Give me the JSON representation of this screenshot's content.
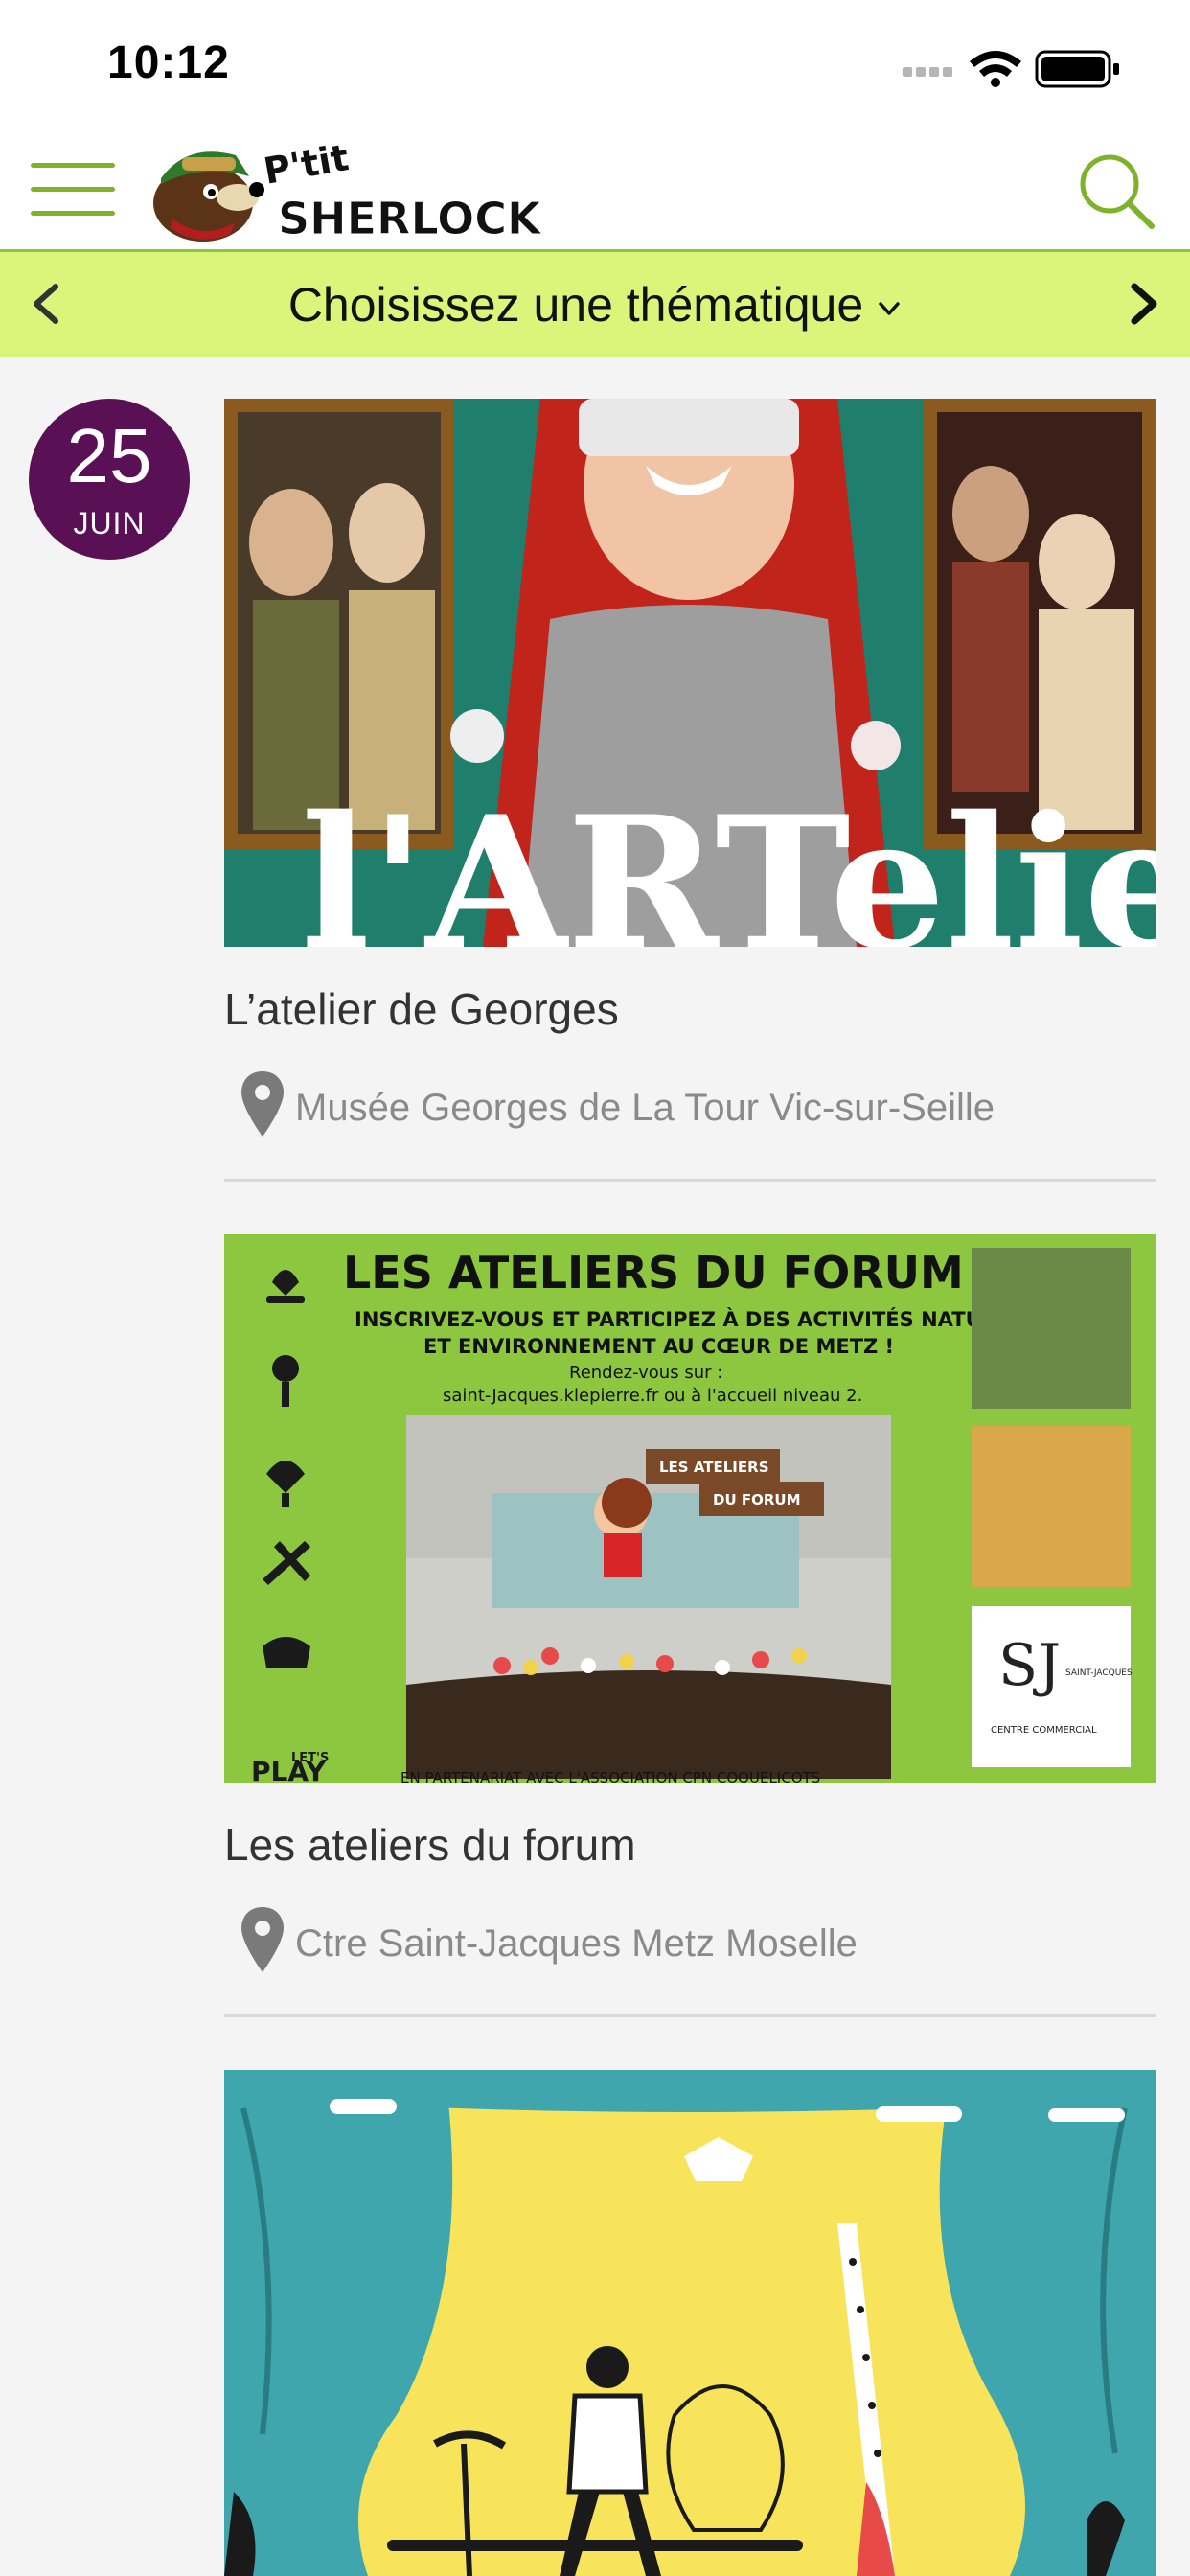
{
  "status": {
    "time": "10:12"
  },
  "header": {
    "logo_text_top": "P'tit",
    "logo_text_bottom": "SHERLOCK"
  },
  "theme_bar": {
    "title": "Choisissez une thématique"
  },
  "date": {
    "day": "25",
    "month": "JUIN"
  },
  "events": [
    {
      "title": "L’atelier de Georges",
      "location": "Musée Georges de La Tour Vic-sur-Seille",
      "image_text": "l'ARTelier"
    },
    {
      "title": "Les ateliers du forum",
      "location": "Ctre Saint-Jacques Metz Moselle",
      "image_text": {
        "headline": "LES ATELIERS DU FORUM",
        "line1": "INSCRIVEZ-VOUS ET PARTICIPEZ À DES ACTIVITÉS NATURE",
        "line2": "ET ENVIRONNEMENT AU CŒUR DE METZ !",
        "line3": "Rendez-vous sur :",
        "line4": "saint-Jacques.klepierre.fr ou à l'accueil niveau 2.",
        "sign1": "LES ATELIERS",
        "sign2": "DU FORUM",
        "brand1": "SAINT-JACQUES",
        "brand2": "CENTRE COMMERCIAL",
        "lets": "LET'S",
        "play": "PLAY",
        "footer": "EN PARTENARIAT AVEC L'ASSOCIATION CPN COQUELICOTS"
      }
    },
    {
      "title": "",
      "location": ""
    }
  ],
  "colors": {
    "accent_green": "#7cb32a",
    "theme_bar_bg": "#dbf57a",
    "date_badge_bg": "#5a1055"
  }
}
